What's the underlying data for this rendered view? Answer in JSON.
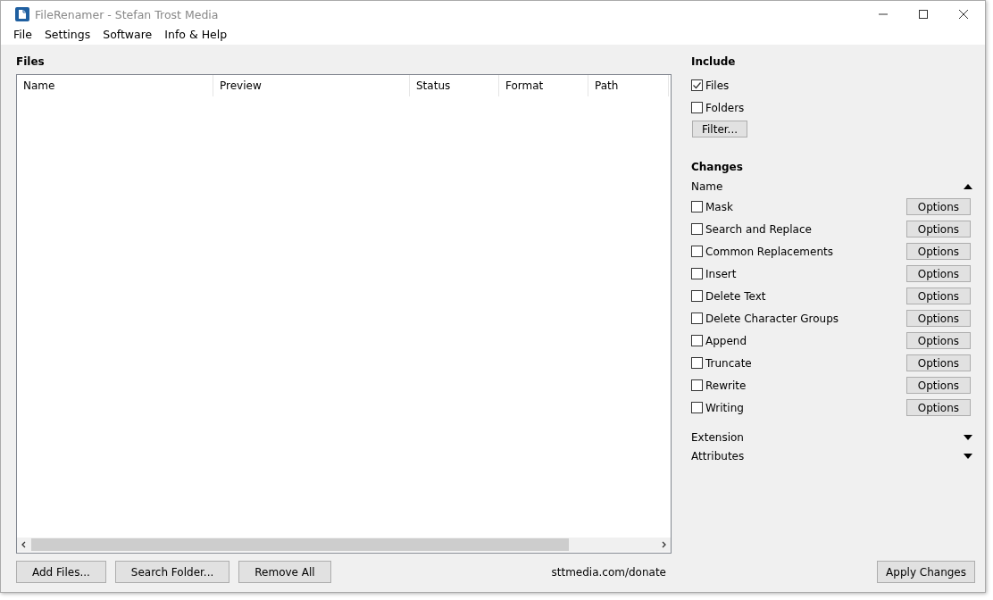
{
  "window": {
    "title": "FileRenamer - Stefan Trost Media"
  },
  "menu": [
    "File",
    "Settings",
    "Software",
    "Info & Help"
  ],
  "files": {
    "title": "Files",
    "columns": [
      "Name",
      "Preview",
      "Status",
      "Format",
      "Path"
    ],
    "buttons": [
      "Add Files...",
      "Search Folder...",
      "Remove All"
    ],
    "link": "sttmedia.com/donate"
  },
  "include": {
    "title": "Include",
    "options": [
      {
        "label": "Files",
        "checked": true
      },
      {
        "label": "Folders",
        "checked": false
      }
    ],
    "filter_button": "Filter..."
  },
  "changes": {
    "title": "Changes",
    "sections": [
      {
        "label": "Name",
        "expanded": true,
        "items": [
          {
            "label": "Mask",
            "checked": false,
            "button": "Options"
          },
          {
            "label": "Search and Replace",
            "checked": false,
            "button": "Options"
          },
          {
            "label": "Common Replacements",
            "checked": false,
            "button": "Options"
          },
          {
            "label": "Insert",
            "checked": false,
            "button": "Options"
          },
          {
            "label": "Delete Text",
            "checked": false,
            "button": "Options"
          },
          {
            "label": "Delete Character Groups",
            "checked": false,
            "button": "Options"
          },
          {
            "label": "Append",
            "checked": false,
            "button": "Options"
          },
          {
            "label": "Truncate",
            "checked": false,
            "button": "Options"
          },
          {
            "label": "Rewrite",
            "checked": false,
            "button": "Options"
          },
          {
            "label": "Writing",
            "checked": false,
            "button": "Options"
          }
        ]
      },
      {
        "label": "Extension",
        "expanded": false
      },
      {
        "label": "Attributes",
        "expanded": false
      }
    ]
  },
  "apply_button": "Apply Changes"
}
